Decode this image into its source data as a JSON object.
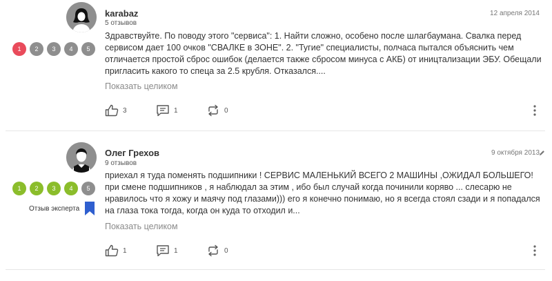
{
  "reviews": [
    {
      "author": "karabaz",
      "review_count": "5 отзывов",
      "date": "12 апреля 2014",
      "avatar": "female-silhouette",
      "rating": {
        "labels": [
          "1",
          "2",
          "3",
          "4",
          "5"
        ],
        "value": 1,
        "active_color": "#e94b5b",
        "inactive_color": "#8e8e8e"
      },
      "text": "Здравствуйте. По поводу этого \"сервиса\": 1. Найти сложно, особено после шлагбаумана. Свалка перед сервисом дает 100 очков \"СВАЛКЕ в ЗОНЕ\". 2. \"Тугие\" специалисты, полчаса пытался объяснить чем отличается простой сброс ошибок (делается также сбросом минуса с АКБ) от иництализации ЭБУ. Обещали пригласить какого то спеца за 2.5 крубля. Отказался....",
      "show_more": "Показать целиком",
      "likes": "3",
      "comments": "1",
      "reposts": "0"
    },
    {
      "author": "Олег Грехов",
      "review_count": "9 отзывов",
      "date": "9 октября 2013",
      "edited_icon": "pencil-icon",
      "avatar": "male-silhouette",
      "rating": {
        "labels": [
          "1",
          "2",
          "3",
          "4",
          "5"
        ],
        "value": 4,
        "active_color": "#8bbd2b",
        "inactive_color": "#8e8e8e"
      },
      "expert_label": "Отзыв эксперта",
      "expert_icon": "bookmark-icon",
      "expert_color": "#2f5fcf",
      "text": "приехал я туда поменять подшипники ! СЕРВИС МАЛЕНЬКИЙ ВСЕГО 2 МАШИНЫ ,ОЖИДАЛ БОЛЬШЕГО! при смене подшипников , я наблюдал за этим , ибо был случай когда починили коряво ... слесарю не нравилось что я хожу и маячу под глазами))) его я конечно понимаю, но я всегда стоял сзади и я попадался на глаза тока тогда, когда он куда то отходил и...",
      "show_more": "Показать целиком",
      "likes": "1",
      "comments": "1",
      "reposts": "0"
    }
  ],
  "icons": [
    "thumbs-up-icon",
    "comment-icon",
    "repost-icon",
    "more-vertical-icon"
  ]
}
